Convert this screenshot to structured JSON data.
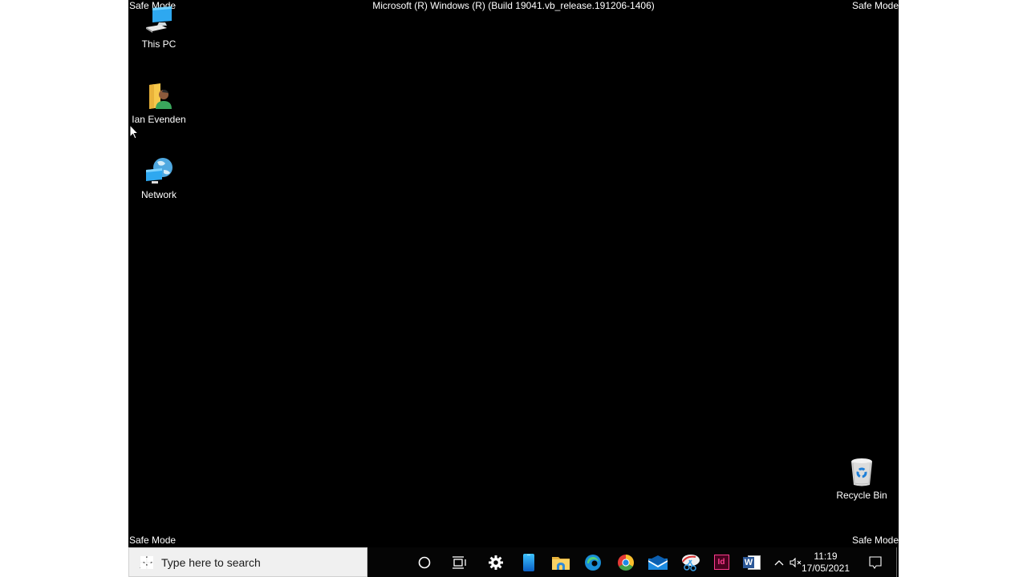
{
  "screen": {
    "safe_mode_label": "Safe Mode",
    "build_string": "Microsoft (R) Windows (R) (Build 19041.vb_release.191206-1406)"
  },
  "desktop_icons": [
    {
      "name": "this-pc",
      "label": "This PC",
      "icon": "computer-icon"
    },
    {
      "name": "user-folder",
      "label": "Ian Evenden",
      "icon": "user-folder-icon"
    },
    {
      "name": "network",
      "label": "Network",
      "icon": "network-icon"
    },
    {
      "name": "recycle-bin",
      "label": "Recycle Bin",
      "icon": "recycle-bin-icon"
    }
  ],
  "taskbar": {
    "search_placeholder": "Type here to search",
    "pinned": [
      {
        "name": "cortana",
        "icon": "cortana-circle-icon"
      },
      {
        "name": "task-view",
        "icon": "task-view-icon"
      },
      {
        "name": "settings",
        "icon": "gear-icon"
      },
      {
        "name": "phone",
        "icon": "phone-icon"
      },
      {
        "name": "file-explorer",
        "icon": "folder-icon"
      },
      {
        "name": "edge",
        "icon": "edge-icon"
      },
      {
        "name": "chrome",
        "icon": "chrome-icon"
      },
      {
        "name": "mail",
        "icon": "mail-icon"
      },
      {
        "name": "snip-sketch",
        "icon": "snip-sketch-icon"
      },
      {
        "name": "indesign",
        "icon": "indesign-icon",
        "text": "Id"
      },
      {
        "name": "word",
        "icon": "word-icon",
        "text": "W"
      }
    ],
    "tray": {
      "time": "11:19",
      "date": "17/05/2021",
      "volume_state": "muted"
    }
  }
}
